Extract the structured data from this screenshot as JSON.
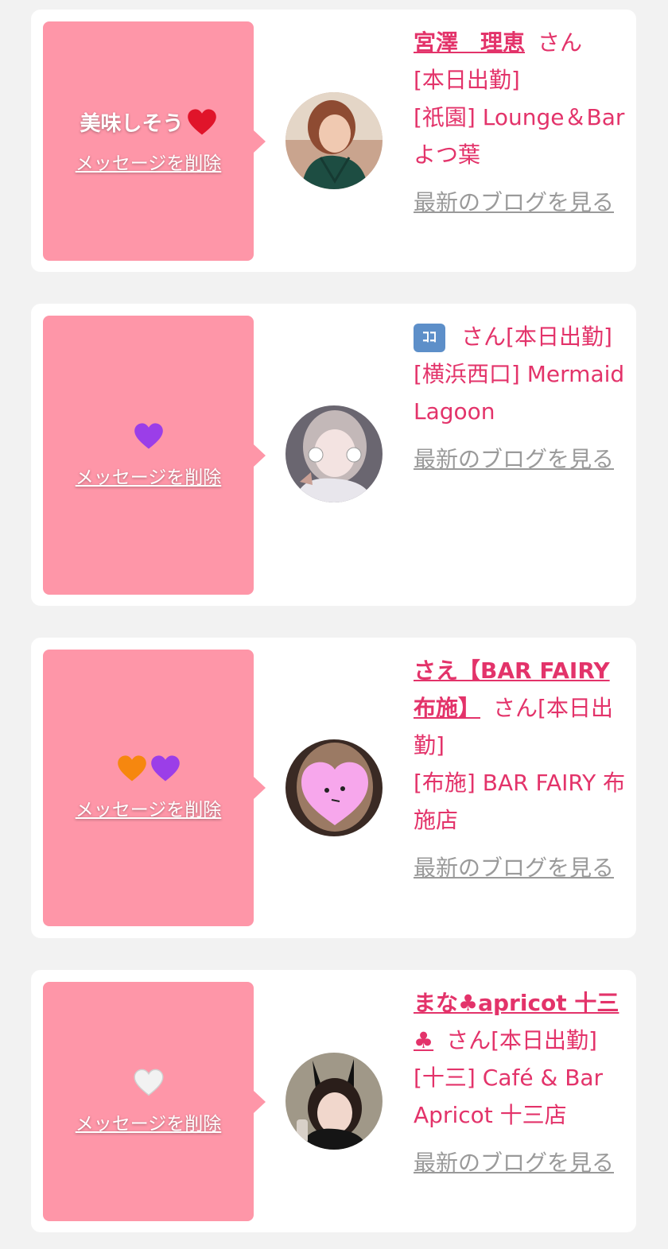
{
  "colors": {
    "accent": "#e3336a",
    "bubble": "#fe96a8",
    "link_gray": "#9a9a9a",
    "background": "#f2f2f2",
    "card": "#ffffff"
  },
  "messages": [
    {
      "text": "美味しそう",
      "emojis": [
        "red-heart"
      ],
      "delete_label": "メッセージを削除",
      "cast": {
        "name": "宮澤　理恵",
        "name_icon": null,
        "honorific": "さん",
        "status": "[本日出勤]",
        "area": "[祇園]",
        "shop": "Lounge＆Barよつ葉",
        "blog_link": "最新のブログを見る"
      }
    },
    {
      "text": "",
      "emojis": [
        "purple-heart"
      ],
      "delete_label": "メッセージを削除",
      "cast": {
        "name": "",
        "name_icon": "ｺｺ",
        "honorific": "さん",
        "status": "[本日出勤]",
        "area": "[横浜西口]",
        "shop": "Mermaid Lagoon",
        "blog_link": "最新のブログを見る"
      }
    },
    {
      "text": "",
      "emojis": [
        "orange-heart",
        "purple-heart"
      ],
      "delete_label": "メッセージを削除",
      "cast": {
        "name": "さえ【BAR FAIRY 布施】",
        "name_icon": null,
        "honorific": "さん",
        "status": "[本日出勤]",
        "area": "[布施]",
        "shop": "BAR FAIRY 布施店",
        "blog_link": "最新のブログを見る"
      }
    },
    {
      "text": "",
      "emojis": [
        "white-heart"
      ],
      "delete_label": "メッセージを削除",
      "cast": {
        "name": "まな♣apricot 十三♣",
        "name_icon": null,
        "honorific": "さん",
        "status": "[本日出勤]",
        "area": "[十三]",
        "shop": "Café & Bar Apricot 十三店",
        "blog_link": "最新のブログを見る"
      }
    }
  ]
}
